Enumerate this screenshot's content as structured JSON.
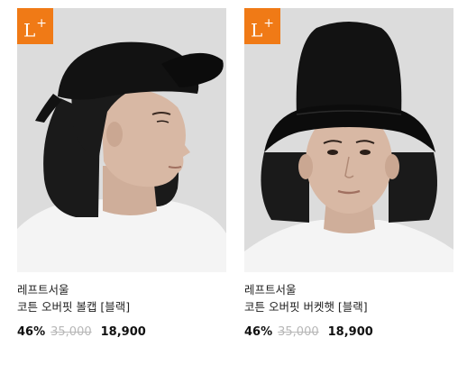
{
  "products": [
    {
      "badge": "L",
      "badge_plus": "+",
      "brand": "레프트서울",
      "name": "코튼 오버핏 볼캡 [블랙]",
      "discount": "46%",
      "original_price": "35,000",
      "sale_price": "18,900",
      "image_subject": "model-wearing-black-ball-cap"
    },
    {
      "badge": "L",
      "badge_plus": "+",
      "brand": "레프트서울",
      "name": "코튼 오버핏 버켓햇 [블랙]",
      "discount": "46%",
      "original_price": "35,000",
      "sale_price": "18,900",
      "image_subject": "model-wearing-black-bucket-hat"
    }
  ],
  "colors": {
    "badge": "#f07a16",
    "image_background": "#dcdcdc",
    "hat": "#121212",
    "hair": "#1a1a1a",
    "skin": "#d8b8a4",
    "shirt": "#f4f4f4",
    "strikethrough_price": "#b7b7b7"
  }
}
